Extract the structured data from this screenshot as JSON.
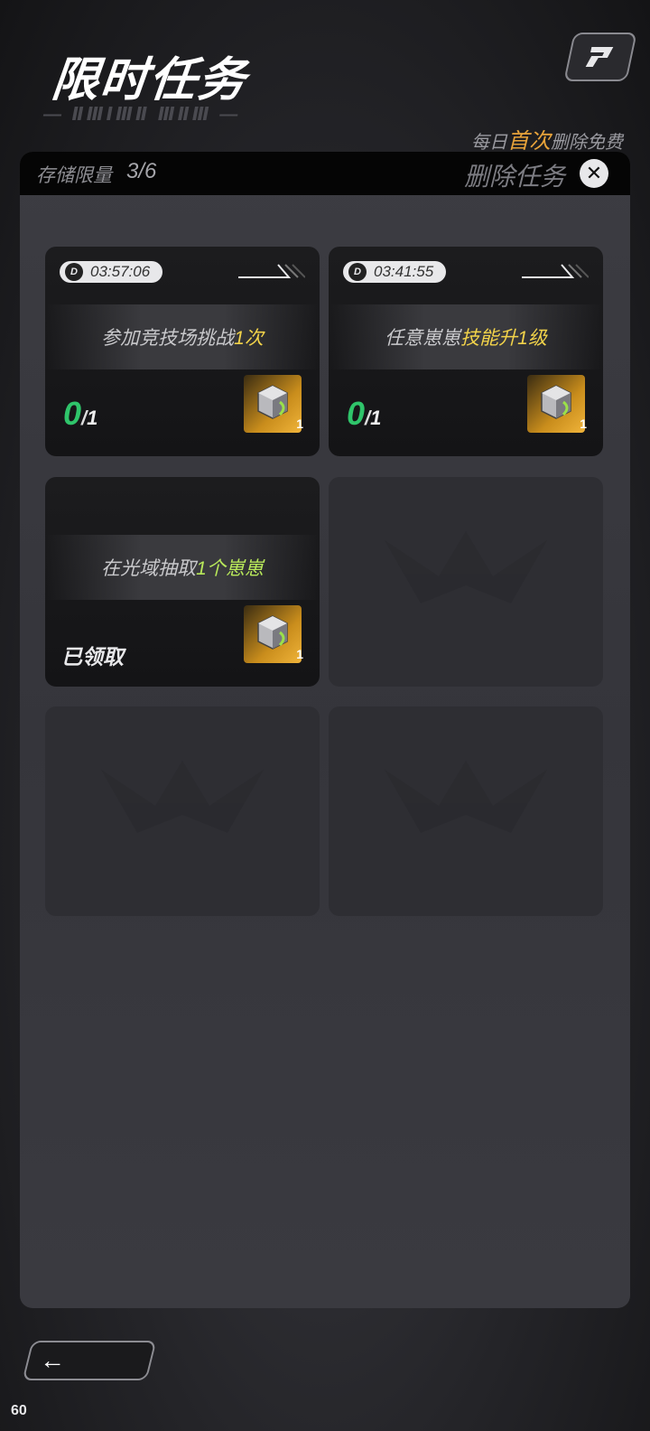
{
  "header": {
    "title": "限时任务",
    "subtitle_deco": "— ⅡⅢⅠⅢⅡ ⅢⅡⅢ —",
    "free_note_prefix": "每日",
    "free_note_highlight": "首次",
    "free_note_suffix": "删除免费"
  },
  "panel": {
    "storage_label": "存储限量",
    "storage_count": "3/6",
    "delete_label": "删除任务",
    "delete_icon": "close-icon"
  },
  "tasks": [
    {
      "timer": "03:57:06",
      "text_plain": "参加竞技场挑战",
      "text_highlight": "1次",
      "highlight_color": "#f2d34a",
      "progress_current": "0",
      "progress_total": "1",
      "reward_count": "1",
      "status": ""
    },
    {
      "timer": "03:41:55",
      "text_plain": "任意崽崽",
      "text_highlight": "技能升1级",
      "highlight_color": "#f2d34a",
      "progress_current": "0",
      "progress_total": "1",
      "reward_count": "1",
      "status": ""
    },
    {
      "timer": "",
      "text_plain": "在光域抽取",
      "text_highlight": "1个崽崽",
      "highlight_color": "#b8e85a",
      "progress_current": "",
      "progress_total": "",
      "reward_count": "1",
      "status": "已领取"
    }
  ],
  "footer": {
    "back_icon": "back-arrow-icon",
    "fps": "60"
  }
}
